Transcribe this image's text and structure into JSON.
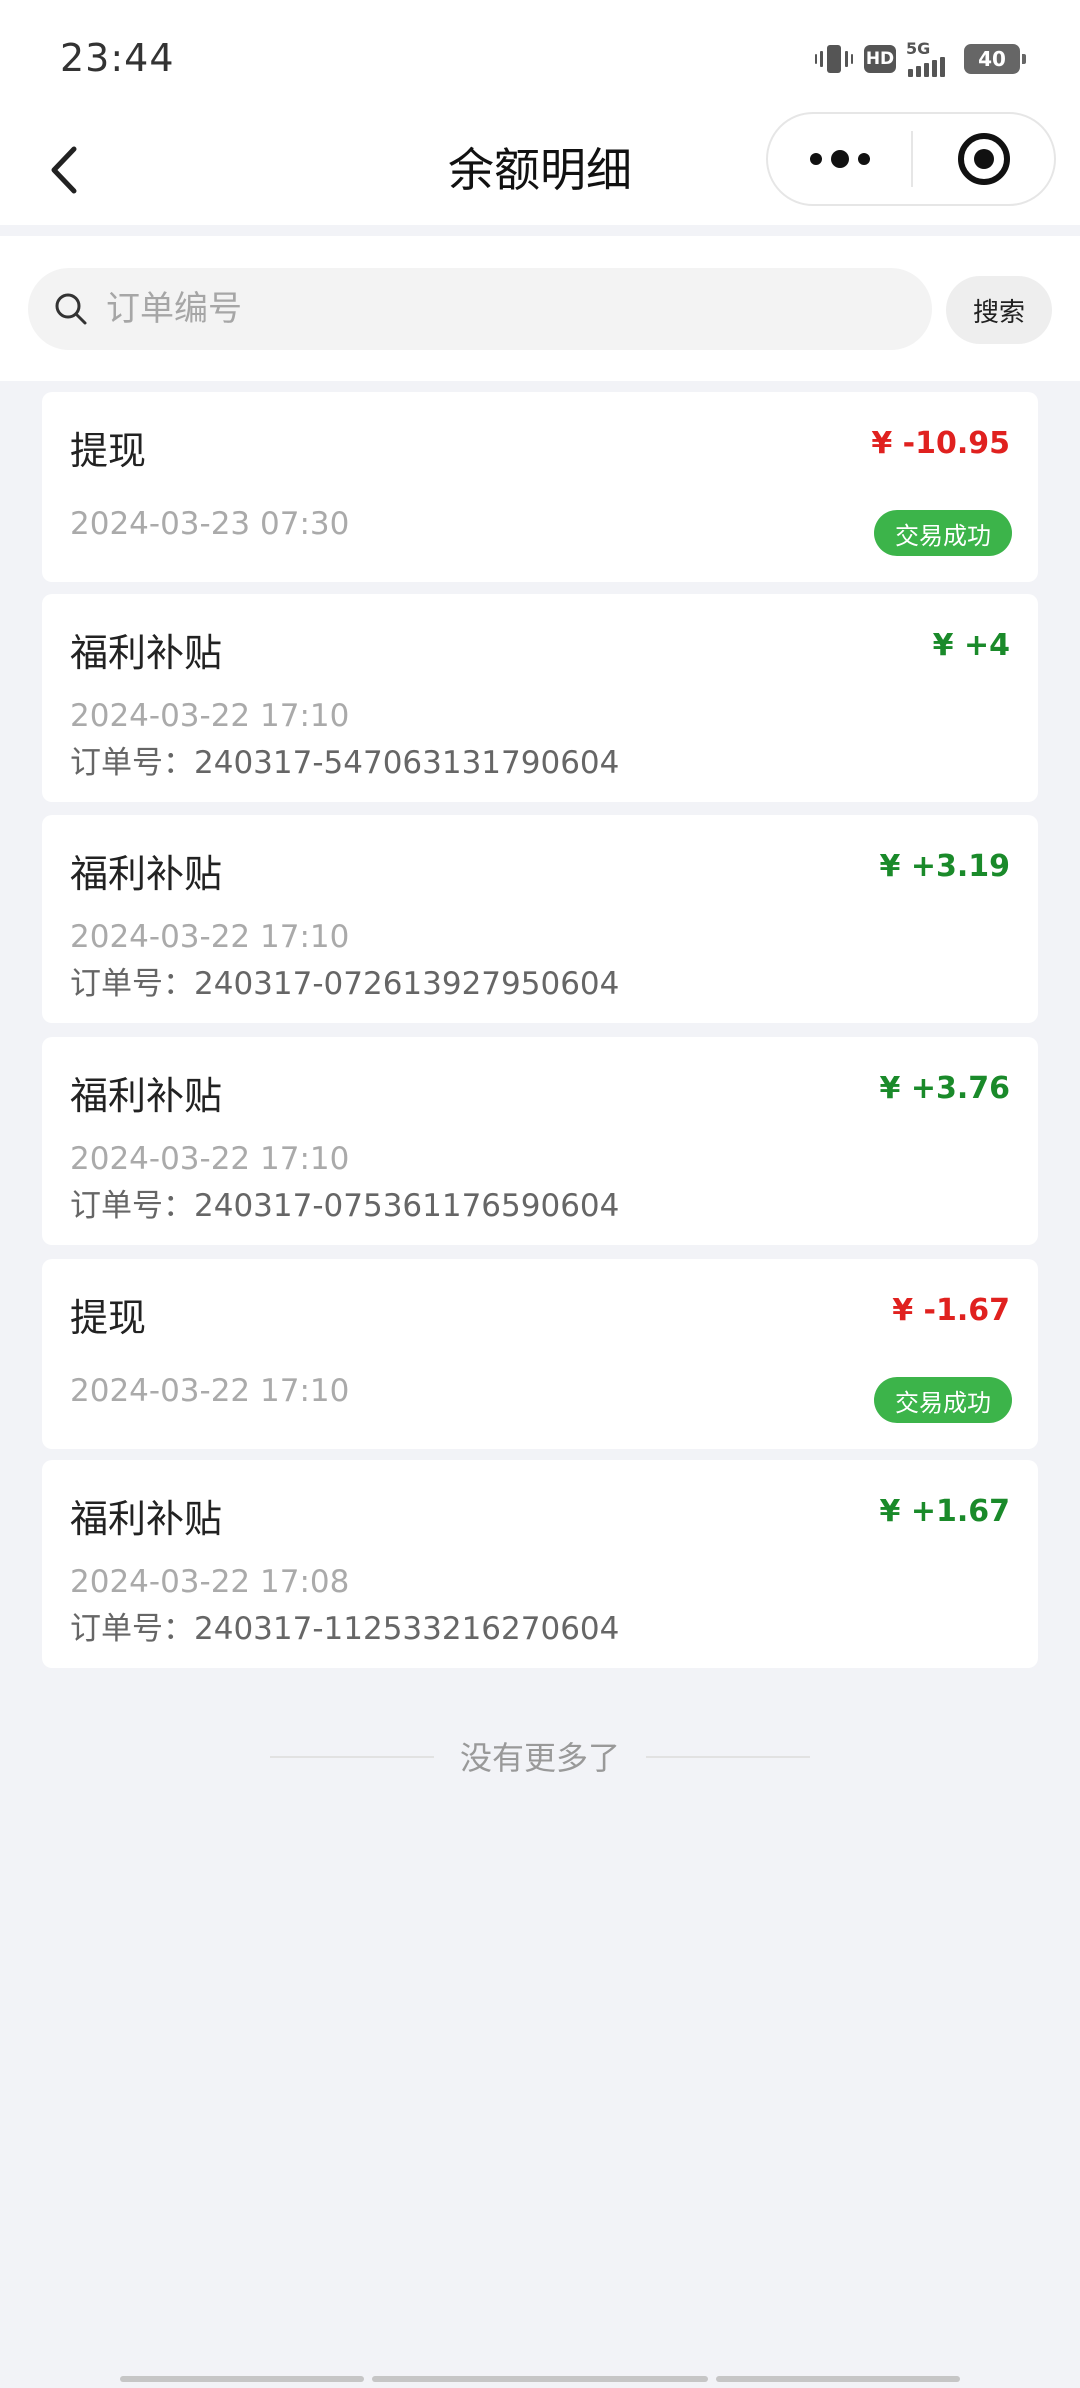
{
  "status_bar": {
    "time": "23:44",
    "hd_label": "HD",
    "network_label": "5G",
    "battery_level": "40"
  },
  "nav": {
    "title": "余额明细"
  },
  "search": {
    "placeholder": "订单编号",
    "value": "",
    "button_label": "搜索"
  },
  "records": [
    {
      "title": "提现",
      "amount": "¥ -10.95",
      "time": "2024-03-23 07:30",
      "badge": "交易成功"
    },
    {
      "title": "福利补贴",
      "amount": "¥ +4",
      "time": "2024-03-22 17:10",
      "order": "订单号：240317-547063131790604"
    },
    {
      "title": "福利补贴",
      "amount": "¥ +3.19",
      "time": "2024-03-22 17:10",
      "order": "订单号：240317-072613927950604"
    },
    {
      "title": "福利补贴",
      "amount": "¥ +3.76",
      "time": "2024-03-22 17:10",
      "order": "订单号：240317-075361176590604"
    },
    {
      "title": "提现",
      "amount": "¥ -1.67",
      "time": "2024-03-22 17:10",
      "badge": "交易成功"
    },
    {
      "title": "福利补贴",
      "amount": "¥ +1.67",
      "time": "2024-03-22 17:08",
      "order": "订单号：240317-112533216270604"
    }
  ],
  "footer": {
    "end_text": "没有更多了"
  },
  "colors": {
    "negative": "#e0211f",
    "positive": "#1a8a2a",
    "success_badge": "#3cb44a",
    "background": "#f2f3f7"
  }
}
